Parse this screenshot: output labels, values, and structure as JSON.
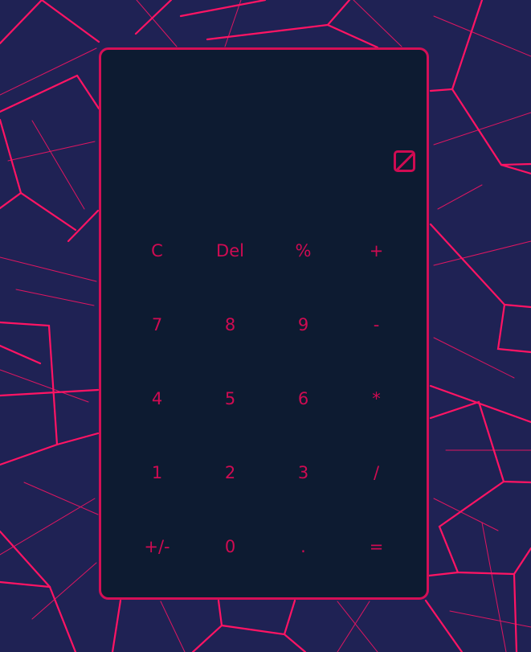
{
  "colors": {
    "page_background": "#1f2254",
    "background_lines": "#ff1464",
    "calculator_background": "#0d1b31",
    "accent": "#cf0b52",
    "border": "#d40f56"
  },
  "display": {
    "value": ""
  },
  "theme_toggle": {
    "icon": "theme-toggle-icon"
  },
  "keys": [
    {
      "name": "clear",
      "label": "C"
    },
    {
      "name": "delete",
      "label": "Del"
    },
    {
      "name": "percent",
      "label": "%"
    },
    {
      "name": "plus",
      "label": "+"
    },
    {
      "name": "7",
      "label": "7"
    },
    {
      "name": "8",
      "label": "8"
    },
    {
      "name": "9",
      "label": "9"
    },
    {
      "name": "minus",
      "label": "-"
    },
    {
      "name": "4",
      "label": "4"
    },
    {
      "name": "5",
      "label": "5"
    },
    {
      "name": "6",
      "label": "6"
    },
    {
      "name": "multiply",
      "label": "*"
    },
    {
      "name": "1",
      "label": "1"
    },
    {
      "name": "2",
      "label": "2"
    },
    {
      "name": "3",
      "label": "3"
    },
    {
      "name": "divide",
      "label": "/"
    },
    {
      "name": "sign",
      "label": "+/-"
    },
    {
      "name": "0",
      "label": "0"
    },
    {
      "name": "decimal",
      "label": "."
    },
    {
      "name": "equals",
      "label": "="
    }
  ]
}
